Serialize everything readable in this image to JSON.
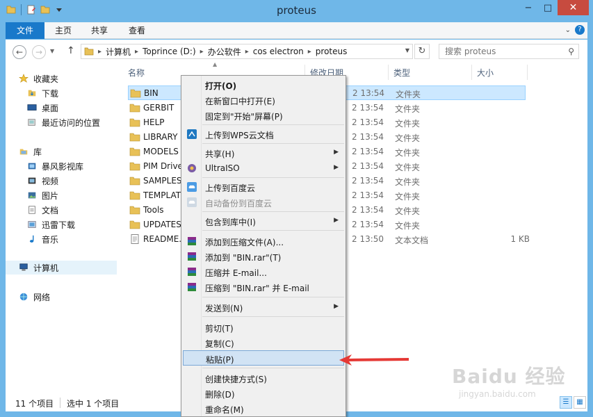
{
  "window": {
    "title": "proteus",
    "minimize": "−",
    "maximize": "□",
    "close": "✕"
  },
  "ribbon": {
    "tabs": [
      "文件",
      "主页",
      "共享",
      "查看"
    ],
    "expand": "⌄",
    "help": "?"
  },
  "address": {
    "back": "←",
    "forward": "→",
    "up": "↑",
    "crumbs": [
      "计算机",
      "Toprince (D:)",
      "办公软件",
      "cos electron",
      "proteus"
    ],
    "refresh": "↻"
  },
  "search": {
    "placeholder": "搜索 proteus",
    "icon": "search-icon"
  },
  "nav": {
    "favorites": "收藏夹",
    "downloads": "下载",
    "desktop": "桌面",
    "recent": "最近访问的位置",
    "libraries": "库",
    "storm": "暴风影视库",
    "video": "视频",
    "pictures": "图片",
    "documents": "文档",
    "xunlei": "迅雷下载",
    "music": "音乐",
    "computer": "计算机",
    "network": "网络"
  },
  "columns": {
    "name": "名称",
    "date": "修改日期",
    "type": "类型",
    "size": "大小"
  },
  "files": [
    {
      "name": "BIN",
      "date": "2 13:54",
      "type": "文件夹",
      "size": ""
    },
    {
      "name": "GERBIT",
      "date": "2 13:54",
      "type": "文件夹",
      "size": ""
    },
    {
      "name": "HELP",
      "date": "2 13:54",
      "type": "文件夹",
      "size": ""
    },
    {
      "name": "LIBRARY",
      "date": "2 13:54",
      "type": "文件夹",
      "size": ""
    },
    {
      "name": "MODELS",
      "date": "2 13:54",
      "type": "文件夹",
      "size": ""
    },
    {
      "name": "PIM Drive",
      "date": "2 13:54",
      "type": "文件夹",
      "size": ""
    },
    {
      "name": "SAMPLES",
      "date": "2 13:54",
      "type": "文件夹",
      "size": ""
    },
    {
      "name": "TEMPLAT",
      "date": "2 13:54",
      "type": "文件夹",
      "size": ""
    },
    {
      "name": "Tools",
      "date": "2 13:54",
      "type": "文件夹",
      "size": ""
    },
    {
      "name": "UPDATES",
      "date": "2 13:54",
      "type": "文件夹",
      "size": ""
    },
    {
      "name": "README.",
      "date": "2 13:50",
      "type": "文本文档",
      "size": "1 KB"
    }
  ],
  "status": {
    "count": "11 个项目",
    "selected": "选中 1 个项目"
  },
  "menu": {
    "open": "打开(O)",
    "open_new": "在新窗口中打开(E)",
    "pin_start": "固定到\"开始\"屏幕(P)",
    "wps_upload": "上传到WPS云文档",
    "share": "共享(H)",
    "ultraiso": "UltraISO",
    "baidu_upload": "上传到百度云",
    "baidu_backup": "自动备份到百度云",
    "include_lib": "包含到库中(I)",
    "add_archive": "添加到压缩文件(A)...",
    "add_bin_rar": "添加到 \"BIN.rar\"(T)",
    "compress_email": "压缩并 E-mail...",
    "compress_bin_email": "压缩到 \"BIN.rar\" 并 E-mail",
    "send_to": "发送到(N)",
    "cut": "剪切(T)",
    "copy": "复制(C)",
    "paste": "粘贴(P)",
    "shortcut": "创建快捷方式(S)",
    "delete": "删除(D)",
    "rename": "重命名(M)",
    "submenu_arrow": "▶"
  },
  "watermark": {
    "brand": "Baidu 经验",
    "url": "jingyan.baidu.com"
  },
  "colors": {
    "titlebar": "#6fb7e8",
    "file_tab": "#1979ca",
    "selection": "#cce8ff",
    "menu_highlight": "#d1e3f4",
    "annotation_arrow": "#e53935",
    "folder": "#e8c157"
  }
}
